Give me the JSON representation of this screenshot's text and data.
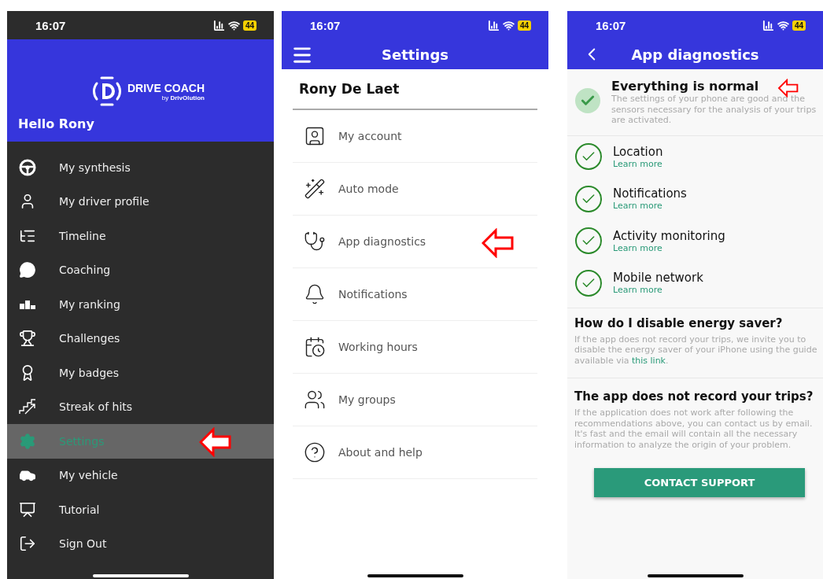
{
  "phones": [
    {
      "status_bar": {
        "time": "16:07",
        "battery": "44"
      }
    },
    {
      "status_bar": {
        "time": "16:07",
        "battery": "44"
      }
    },
    {
      "status_bar": {
        "time": "16:07",
        "battery": "44"
      }
    }
  ],
  "drawer": {
    "brand": "DRIVE COACH",
    "brand_sub_prefix": "by",
    "brand_sub": "DrivOlution",
    "greeting": "Hello Rony",
    "items": [
      {
        "label": "My synthesis",
        "selected": false
      },
      {
        "label": "My driver profile",
        "selected": false
      },
      {
        "label": "Timeline",
        "selected": false
      },
      {
        "label": "Coaching",
        "selected": false
      },
      {
        "label": "My ranking",
        "selected": false
      },
      {
        "label": "Challenges",
        "selected": false
      },
      {
        "label": "My badges",
        "selected": false
      },
      {
        "label": "Streak of hits",
        "selected": false
      },
      {
        "label": "Settings",
        "selected": true
      },
      {
        "label": "My vehicle",
        "selected": false
      },
      {
        "label": "Tutorial",
        "selected": false
      },
      {
        "label": "Sign Out",
        "selected": false
      }
    ]
  },
  "settings": {
    "title": "Settings",
    "user_name": "Rony De Laet",
    "items": [
      {
        "label": "My account"
      },
      {
        "label": "Auto mode"
      },
      {
        "label": "App diagnostics"
      },
      {
        "label": "Notifications"
      },
      {
        "label": "Working hours"
      },
      {
        "label": "My groups"
      },
      {
        "label": "About and help"
      }
    ]
  },
  "diagnostics": {
    "title": "App diagnostics",
    "summary": {
      "title": "Everything is normal",
      "text": "The settings of your phone are good and the sensors necessary for the analysis of your trips are activated."
    },
    "checks": [
      {
        "label": "Location",
        "link": "Learn more",
        "ok": true
      },
      {
        "label": "Notifications",
        "link": "Learn more",
        "ok": true
      },
      {
        "label": "Activity monitoring",
        "link": "Learn more",
        "ok": true
      },
      {
        "label": "Mobile network",
        "link": "Learn more",
        "ok": true
      }
    ],
    "sections": [
      {
        "title": "How do I disable energy saver?",
        "text": "If the app does not record your trips, we invite you to disable the energy saver of your iPhone using the guide available via",
        "link": "this link",
        "after": "."
      },
      {
        "title": "The app does not record your trips?",
        "text": "If the application does not work after following the recommendations above, you can contact us by email. It's fast and the email will contain all the necessary information to analyze the origin of your problem."
      }
    ],
    "button": "CONTACT SUPPORT"
  }
}
